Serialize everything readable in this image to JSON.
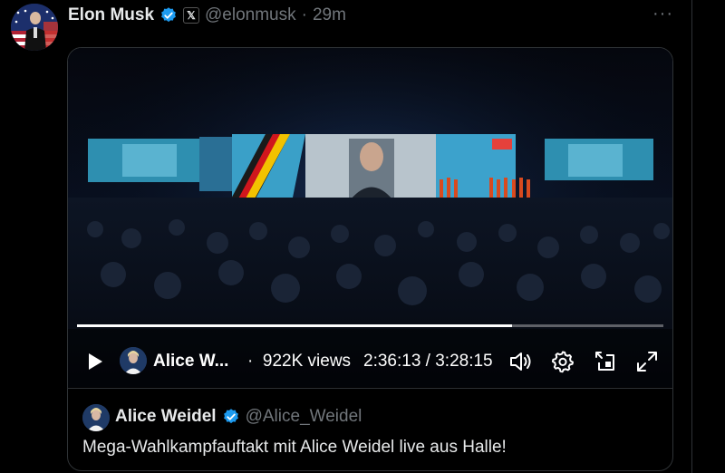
{
  "post": {
    "author_name": "Elon Musk",
    "author_handle": "@elonmusk",
    "separator": "·",
    "time": "29m",
    "x_badge": "𝕏",
    "more": "···"
  },
  "video": {
    "progress": 0.742,
    "channel_name": "Alice W...",
    "separator": "·",
    "views": "922K views",
    "timecode": "2:36:13 / 3:28:15",
    "icons": [
      "play-icon",
      "volume-icon",
      "gear-icon",
      "picture-in-picture-icon",
      "fullscreen-icon"
    ]
  },
  "quote": {
    "author_name": "Alice Weidel",
    "author_handle": "@Alice_Weidel",
    "text": "Mega-Wahlkampfauftakt mit Alice Weidel live aus Halle!"
  },
  "colors": {
    "background": "#000000",
    "text": "#e7e9ea",
    "secondary_text": "#71767b",
    "verified": "#1d9bf0",
    "border": "#2f3336"
  }
}
